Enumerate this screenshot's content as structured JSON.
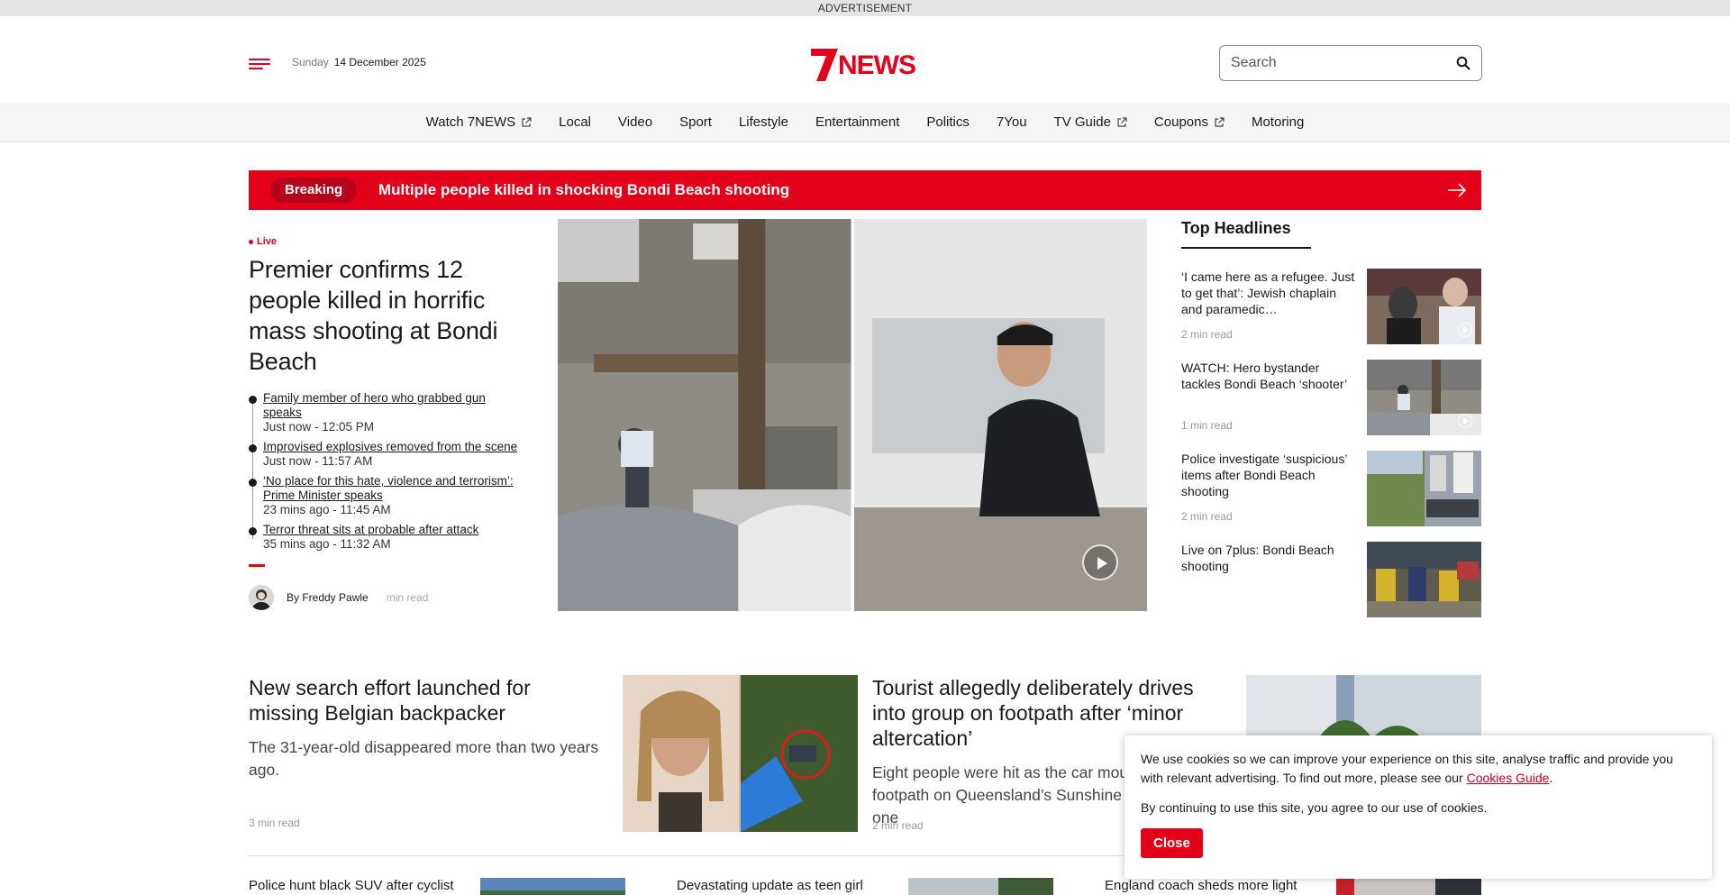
{
  "ad_label": "ADVERTISEMENT",
  "header": {
    "day": "Sunday",
    "date": "14 December 2025",
    "logo_alt": "7NEWS",
    "search_placeholder": "Search"
  },
  "nav": [
    {
      "label": "Watch 7NEWS",
      "external": true
    },
    {
      "label": "Local"
    },
    {
      "label": "Video"
    },
    {
      "label": "Sport"
    },
    {
      "label": "Lifestyle"
    },
    {
      "label": "Entertainment"
    },
    {
      "label": "Politics"
    },
    {
      "label": "7You"
    },
    {
      "label": "TV Guide",
      "external": true
    },
    {
      "label": "Coupons",
      "external": true
    },
    {
      "label": "Motoring"
    }
  ],
  "breaking": {
    "tag": "Breaking",
    "headline": "Multiple people killed in shocking Bondi Beach shooting"
  },
  "lead": {
    "live_label": "Live",
    "headline": "Premier confirms 12 people killed in horrific mass shooting at Bondi Beach",
    "updates": [
      {
        "title": "Family member of hero who grabbed gun speaks",
        "time": "Just now - 12:05 PM"
      },
      {
        "title": "Improvised explosives removed from the scene",
        "time": "Just now - 11:57 AM"
      },
      {
        "title": "‘No place for this hate, violence and terrorism’: Prime Minister speaks",
        "time": "23 mins ago - 11:45 AM"
      },
      {
        "title": "Terror threat sits at probable after attack",
        "time": "35 mins ago - 11:32 AM"
      }
    ],
    "author": "By Freddy Pawle",
    "read_time": "min read"
  },
  "top_headlines": {
    "title": "Top Headlines",
    "items": [
      {
        "title": "‘I came here as a refugee. Just to get that’: Jewish chaplain and paramedic…",
        "read_time": "2 min read",
        "video": true
      },
      {
        "title": "WATCH: Hero bystander tackles Bondi Beach ‘shooter’",
        "read_time": "1 min read",
        "video": true
      },
      {
        "title": "Police investigate ‘suspicious’ items after Bondi Beach shooting",
        "read_time": "2 min read",
        "video": false
      },
      {
        "title": "Live on 7plus: Bondi Beach shooting",
        "read_time": "",
        "video": false
      }
    ]
  },
  "stories": [
    {
      "title": "New search effort launched for missing Belgian backpacker",
      "summary": "The 31-year-old disappeared more than two years ago.",
      "read_time": "3 min read"
    },
    {
      "title": "Tourist allegedly deliberately drives into group on footpath after ‘minor altercation’",
      "summary": "Eight people were hit as the car mounted the footpath on Queensland’s Sunshine Coast with one",
      "read_time": "2 min read"
    }
  ],
  "bottom": [
    {
      "title": "Police hunt black SUV after cyclist"
    },
    {
      "title": "Devastating update as teen girl"
    },
    {
      "title": "England coach sheds more light"
    }
  ],
  "cookie": {
    "text1": "We use cookies so we can improve your experience on this site, analyse traffic and provide you with relevant advertising. To find out more, please see our",
    "link": "Cookies Guide",
    "text2": "By continuing to use this site, you agree to our use of cookies.",
    "button": "Close"
  },
  "colors": {
    "brand_red": "#e2001a",
    "nav_bg": "#f6f5f4",
    "ad_bg": "#e6e4e3"
  }
}
